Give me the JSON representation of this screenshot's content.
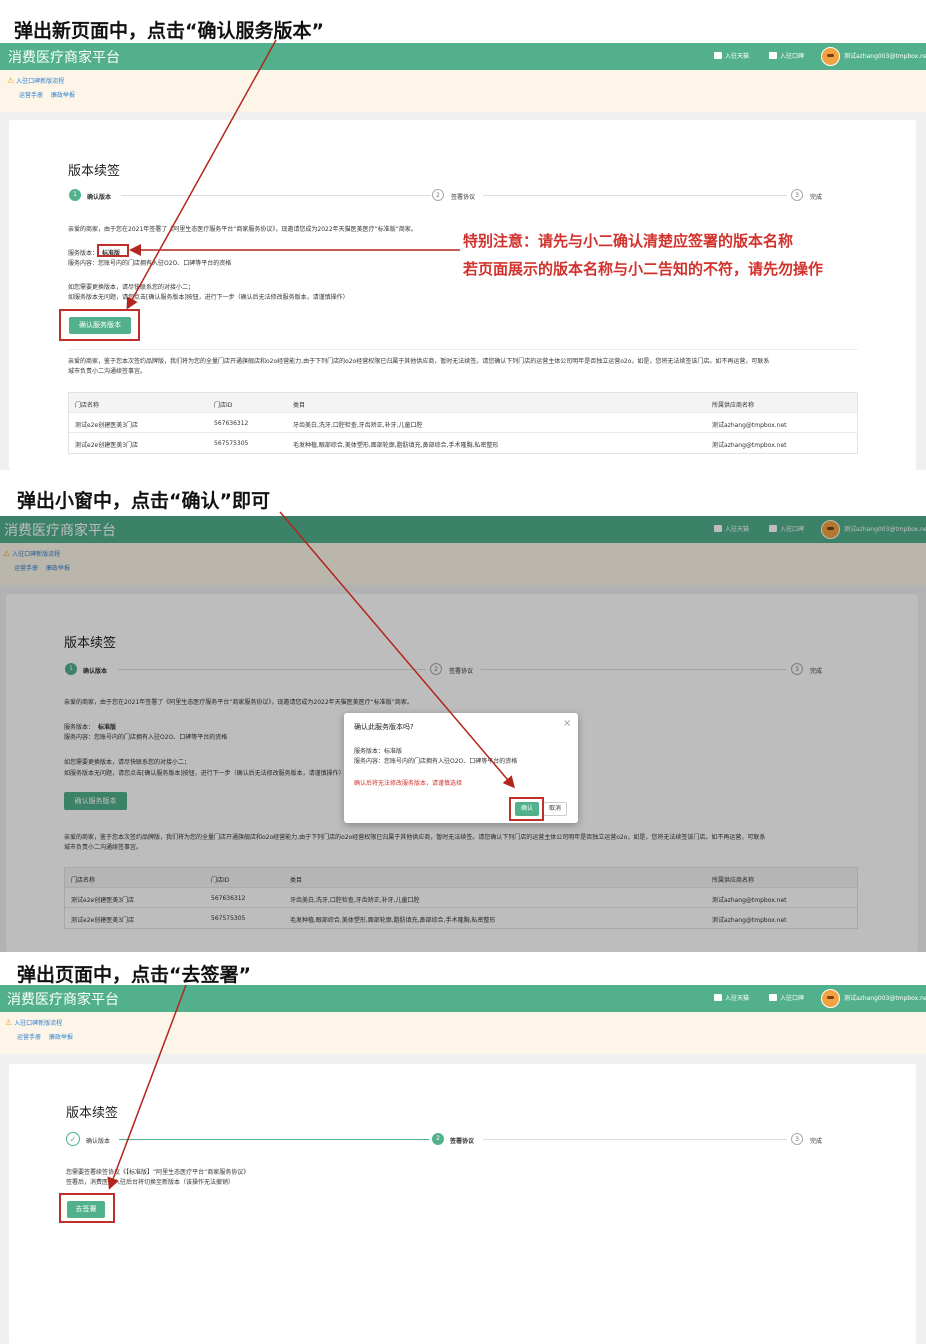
{
  "captions": {
    "step1": "弹出新页面中，点击“确认服务版本”",
    "step2": "弹出小窗中，点击“确认”即可",
    "step3": "弹出页面中，点击“去签署”"
  },
  "app": {
    "title": "消费医疗商家平台",
    "nav": [
      "入驻天猫",
      "入驻口碑"
    ],
    "user": "测试azhang003@tmpbox.net"
  },
  "notice": {
    "line1": "入驻口碑新版流程",
    "links": [
      "运营手册",
      "廉政举报"
    ]
  },
  "page": {
    "heading": "版本续签",
    "steps": [
      {
        "num": "1",
        "label": "确认版本"
      },
      {
        "num": "2",
        "label": "签署协议"
      },
      {
        "num": "3",
        "label": "完成"
      }
    ],
    "intro": "亲爱的商家，由于您在2021年签署了《阿里生态医疗服务平台“商家服务协议》，现邀请您成为2022年天猫医美医疗“标准版”商家。",
    "version_label": "服务版本：",
    "version_value": "标准版",
    "content_line": "服务内容：您账号内的门店拥有入驻O2O、口碑等平台的资格",
    "change_line1": "如您需要更换版本，请尽快联系您的对接小二；",
    "change_line2": "如服务版本无问题，请您点击[确认服务版本]按钮，进行下一步（确认后无法修改服务版本，请谨慎操作）",
    "confirm_button": "确认服务版本",
    "brand_note": "亲爱的商家，鉴于您本次签约品牌版，我们将为您的全量门店开通旗舰店和o2o经营能力,由于下列门店的o2o经营权限已归属于其他供应商，暂时无法续签。请您确认下列门店的运营主体公司明年是否独立运营o2o，如是，您将无法续签该门店。如不再运营，可联系",
    "brand_note2": "城市负责小二沟通续签事宜。",
    "table": {
      "headers": [
        "门店名称",
        "门店ID",
        "类目",
        "所属供应商名称"
      ],
      "rows": [
        [
          "测试e2e创建医美3门店",
          "567636312",
          "牙齿美白,洗牙,口腔检查,牙齿矫正,补牙,儿童口腔",
          "测试azhang@tmpbox.net"
        ],
        [
          "测试e2e创建医美3门店",
          "567575305",
          "毛发种植,眼部综合,美体塑形,面部轮廓,脂肪填充,鼻部综合,手术隆胸,私密整形",
          "测试azhang@tmpbox.net"
        ]
      ]
    }
  },
  "annotation": {
    "line1": "特别注意：请先与小二确认清楚应签署的版本名称",
    "line2": "若页面展示的版本名称与小二告知的不符，请先勿操作"
  },
  "dialog": {
    "title": "确认此服务版本吗?",
    "version": "服务版本：标准版",
    "content": "服务内容：您账号内的门店拥有入驻O2O、口碑等平台的资格",
    "warning": "确认后将无法修改服务版本，请谨慎选择",
    "ok": "确认",
    "cancel": "取消",
    "close": "×"
  },
  "sign": {
    "line1": "您需要签署续签协议《【标准版】“阿里生态医疗平台”商家服务协议》",
    "line2": "签署后，消费医疗入驻后台将切换至新版本（该操作无法撤销）",
    "button": "去签署",
    "done_mark": "✓"
  },
  "colors": {
    "brand": "#52b08d",
    "annotation": "#d2322d",
    "highlight": "#c0302b"
  }
}
